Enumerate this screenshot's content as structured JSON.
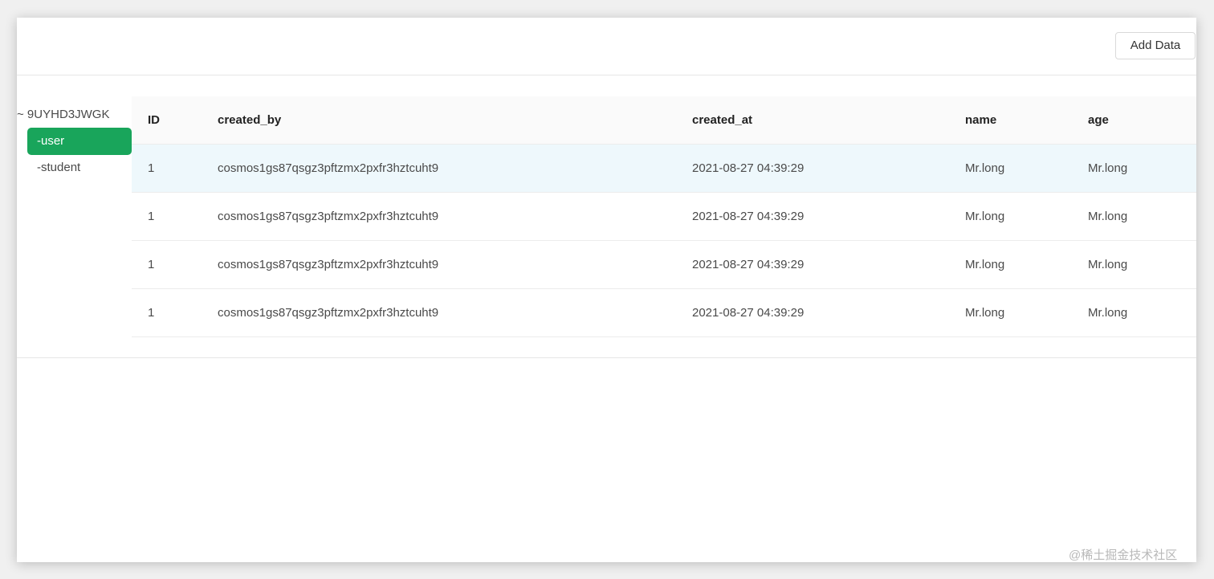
{
  "toolbar": {
    "add_data_label": "Add Data"
  },
  "tree": {
    "root_label": "~ 9UYHD3JWGK",
    "items": [
      {
        "label": "-user",
        "active": true
      },
      {
        "label": "-student",
        "active": false
      }
    ]
  },
  "table": {
    "columns": [
      "ID",
      "created_by",
      "created_at",
      "name",
      "age"
    ],
    "rows": [
      {
        "id": "1",
        "created_by": "cosmos1gs87qsgz3pftzmx2pxfr3hztcuht9",
        "created_at": "2021-08-27 04:39:29",
        "name": "Mr.long",
        "age": "Mr.long"
      },
      {
        "id": "1",
        "created_by": "cosmos1gs87qsgz3pftzmx2pxfr3hztcuht9",
        "created_at": "2021-08-27 04:39:29",
        "name": "Mr.long",
        "age": "Mr.long"
      },
      {
        "id": "1",
        "created_by": "cosmos1gs87qsgz3pftzmx2pxfr3hztcuht9",
        "created_at": "2021-08-27 04:39:29",
        "name": "Mr.long",
        "age": "Mr.long"
      },
      {
        "id": "1",
        "created_by": "cosmos1gs87qsgz3pftzmx2pxfr3hztcuht9",
        "created_at": "2021-08-27 04:39:29",
        "name": "Mr.long",
        "age": "Mr.long"
      }
    ]
  },
  "colors": {
    "active_tree_item": "#19a55b",
    "row_highlight": "#eef8fc",
    "header_bg": "#fafafa"
  },
  "watermark": "@稀土掘金技术社区"
}
